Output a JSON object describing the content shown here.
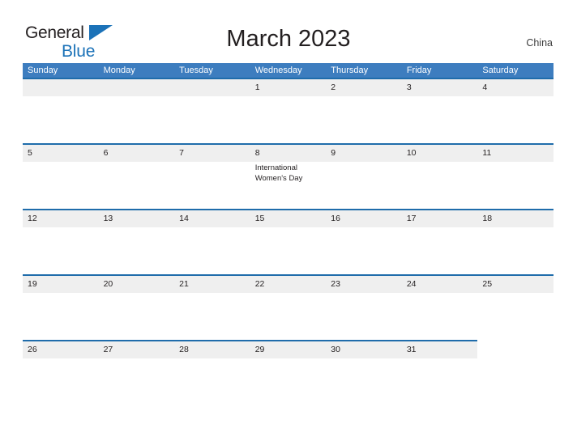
{
  "header": {
    "logo": {
      "text_primary": "General",
      "text_secondary": "Blue",
      "triangle_icon": "blue-triangle-icon",
      "primary_color": "#231f20",
      "secondary_color": "#1b72b8"
    },
    "title": "March 2023",
    "region": "China"
  },
  "calendar": {
    "header_bg": "#3d7dbf",
    "band_bg": "#efefef",
    "band_border": "#1f6cab",
    "weekdays": [
      "Sunday",
      "Monday",
      "Tuesday",
      "Wednesday",
      "Thursday",
      "Friday",
      "Saturday"
    ],
    "weeks": [
      {
        "band_columns": 7,
        "days": [
          {
            "num": "",
            "event": ""
          },
          {
            "num": "",
            "event": ""
          },
          {
            "num": "",
            "event": ""
          },
          {
            "num": "1",
            "event": ""
          },
          {
            "num": "2",
            "event": ""
          },
          {
            "num": "3",
            "event": ""
          },
          {
            "num": "4",
            "event": ""
          }
        ]
      },
      {
        "band_columns": 7,
        "days": [
          {
            "num": "5",
            "event": ""
          },
          {
            "num": "6",
            "event": ""
          },
          {
            "num": "7",
            "event": ""
          },
          {
            "num": "8",
            "event": "International Women's Day"
          },
          {
            "num": "9",
            "event": ""
          },
          {
            "num": "10",
            "event": ""
          },
          {
            "num": "11",
            "event": ""
          }
        ]
      },
      {
        "band_columns": 7,
        "days": [
          {
            "num": "12",
            "event": ""
          },
          {
            "num": "13",
            "event": ""
          },
          {
            "num": "14",
            "event": ""
          },
          {
            "num": "15",
            "event": ""
          },
          {
            "num": "16",
            "event": ""
          },
          {
            "num": "17",
            "event": ""
          },
          {
            "num": "18",
            "event": ""
          }
        ]
      },
      {
        "band_columns": 7,
        "days": [
          {
            "num": "19",
            "event": ""
          },
          {
            "num": "20",
            "event": ""
          },
          {
            "num": "21",
            "event": ""
          },
          {
            "num": "22",
            "event": ""
          },
          {
            "num": "23",
            "event": ""
          },
          {
            "num": "24",
            "event": ""
          },
          {
            "num": "25",
            "event": ""
          }
        ]
      },
      {
        "band_columns": 6,
        "days": [
          {
            "num": "26",
            "event": ""
          },
          {
            "num": "27",
            "event": ""
          },
          {
            "num": "28",
            "event": ""
          },
          {
            "num": "29",
            "event": ""
          },
          {
            "num": "30",
            "event": ""
          },
          {
            "num": "31",
            "event": ""
          },
          {
            "num": "",
            "event": ""
          }
        ]
      }
    ]
  }
}
